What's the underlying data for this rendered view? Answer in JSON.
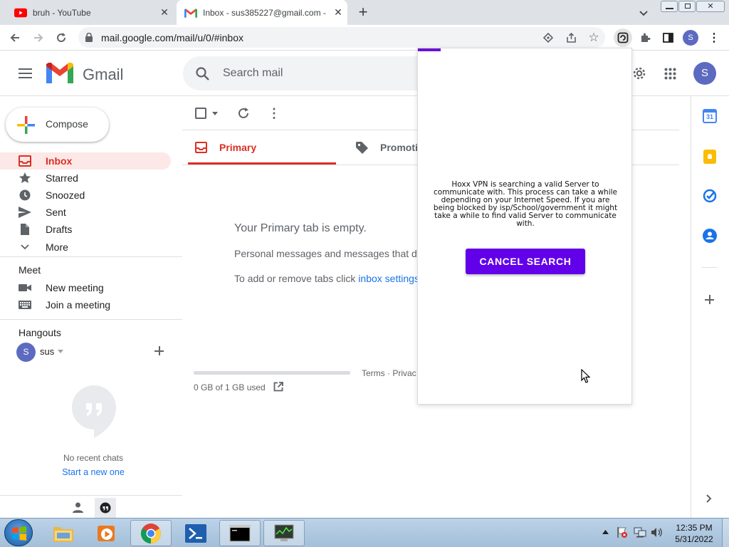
{
  "browser": {
    "tabs": [
      {
        "title": "bruh - YouTube",
        "close": "✕"
      },
      {
        "title": "Inbox - sus385227@gmail.com -",
        "close": "✕"
      }
    ],
    "new_tab": "+",
    "url": "mail.google.com/mail/u/0/#inbox",
    "profile_initial": "S"
  },
  "gmail": {
    "logo_text": "Gmail",
    "search_placeholder": "Search mail",
    "account_initial": "S",
    "compose_label": "Compose",
    "nav": [
      {
        "label": "Inbox"
      },
      {
        "label": "Starred"
      },
      {
        "label": "Snoozed"
      },
      {
        "label": "Sent"
      },
      {
        "label": "Drafts"
      },
      {
        "label": "More"
      }
    ],
    "meet": {
      "heading": "Meet",
      "new_meeting": "New meeting",
      "join_meeting": "Join a meeting"
    },
    "hangouts": {
      "heading": "Hangouts",
      "user_initial": "S",
      "user_name": "sus",
      "no_chats": "No recent chats",
      "start_new": "Start a new one"
    },
    "tabs": {
      "primary": "Primary",
      "promotions": "Promoti"
    },
    "empty": {
      "title": "Your Primary tab is empty.",
      "line1": "Personal messages and messages that d",
      "line2_prefix": "To add or remove tabs click ",
      "line2_link": "inbox settings"
    },
    "footer": {
      "terms": "Terms · Privac",
      "storage": "0 GB of 1 GB used",
      "storage_used_fraction": 0.0
    },
    "calendar_day": "31"
  },
  "vpn_popup": {
    "message": "Hoxx VPN is searching a valid Server to communicate with. This process can take a while depending on your Internet Speed. If you are being blocked by isp/School/government it might take a while to find valid Server to communicate with.",
    "cancel_label": "CANCEL SEARCH",
    "accent": "#6200ea"
  },
  "taskbar": {
    "time": "12:35 PM",
    "date": "5/31/2022"
  }
}
